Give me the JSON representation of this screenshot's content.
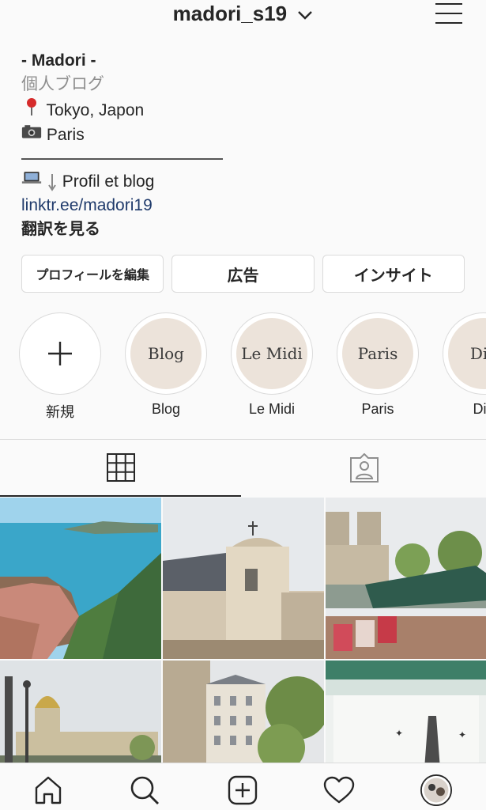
{
  "header": {
    "username": "madori_s19"
  },
  "bio": {
    "name": "- Madori -",
    "category": "個人ブログ",
    "line_location": "Tokyo, Japon",
    "line_camera": "Paris",
    "line_profile": "Profil et blog",
    "link": "linktr.ee/madori19",
    "translate": "翻訳を見る"
  },
  "actions": {
    "edit": "プロフィールを編集",
    "ads": "広告",
    "insights": "インサイト"
  },
  "highlights": [
    {
      "label": "新規",
      "cover": ""
    },
    {
      "label": "Blog",
      "cover": "Blog"
    },
    {
      "label": "Le Midi",
      "cover": "Le Midi"
    },
    {
      "label": "Paris",
      "cover": "Paris"
    },
    {
      "label": "Dia",
      "cover": "Dia"
    }
  ],
  "colors": {
    "link": "#1f3a6b",
    "highlight_fill": "#ece3da",
    "border": "#dbdbdb"
  }
}
